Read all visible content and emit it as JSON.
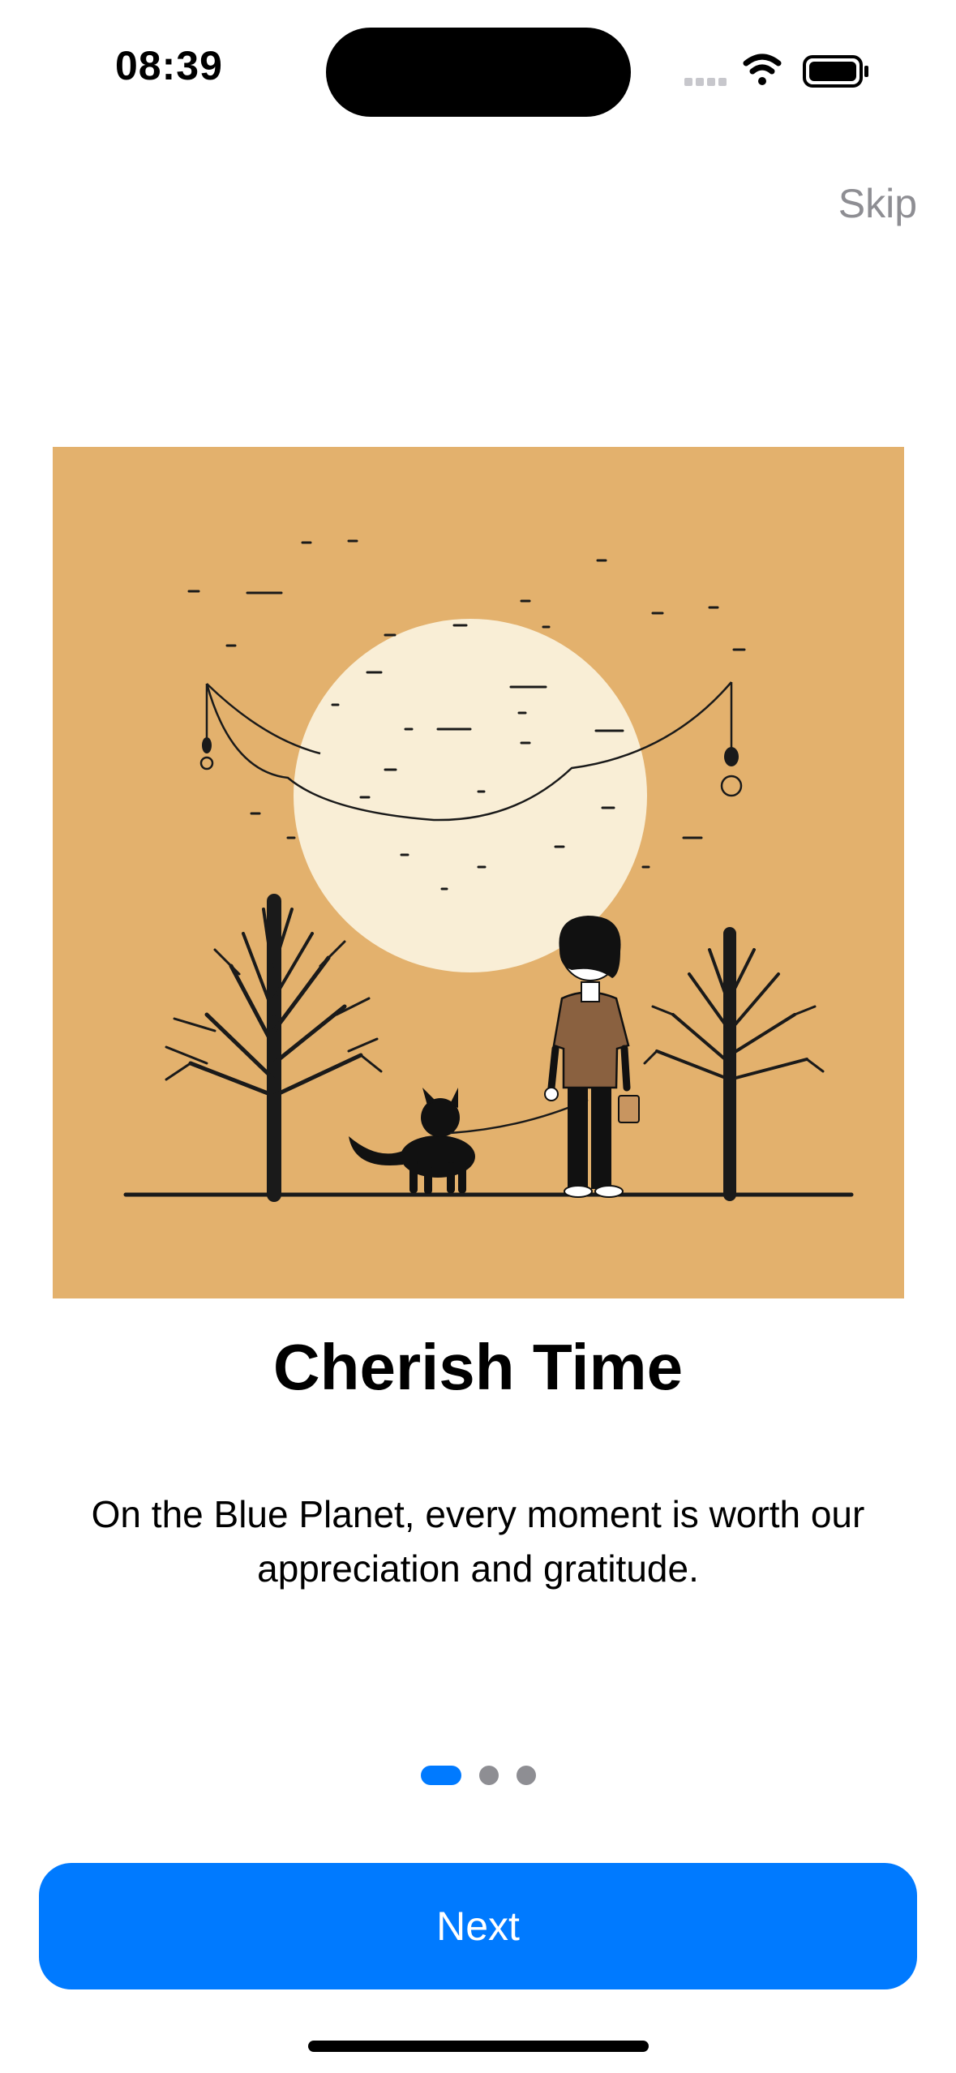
{
  "status_bar": {
    "time": "08:39",
    "icons": [
      "cellular-signal-icon",
      "wifi-icon",
      "battery-icon"
    ]
  },
  "header": {
    "skip_label": "Skip"
  },
  "onboarding": {
    "illustration": "boy-walking-dog-under-moon-illustration",
    "title": "Cherish Time",
    "description": "On the Blue Planet, every moment is worth our appreciation and gratitude.",
    "page_index": 1,
    "page_count": 3
  },
  "footer": {
    "next_label": "Next"
  },
  "colors": {
    "accent": "#007aff",
    "inactive_dot": "#8e8e93",
    "illustration_bg": "#e3b16d",
    "moon": "#f9eed6",
    "shirt": "#8a6140"
  }
}
